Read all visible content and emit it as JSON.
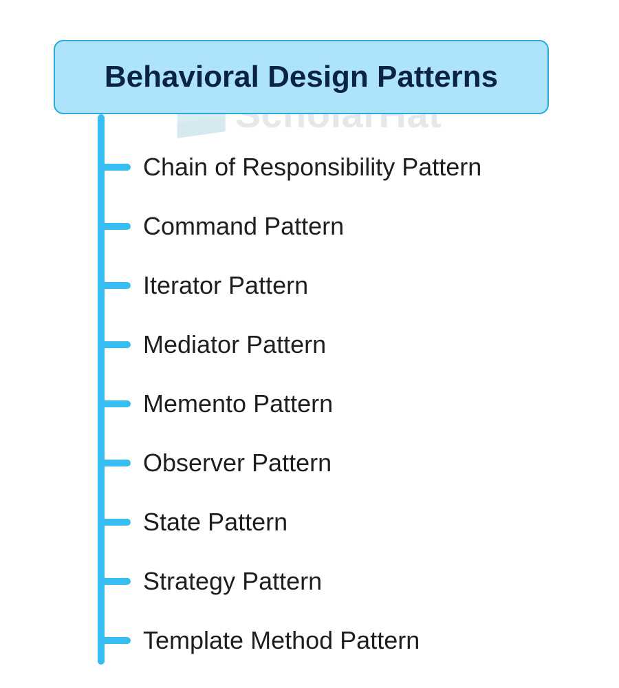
{
  "watermark": {
    "text": "ScholarHat"
  },
  "title": "Behavioral Design Patterns",
  "colors": {
    "title_bg": "#aee4fb",
    "title_border": "#2aa9e0",
    "title_text": "#0b2344",
    "line": "#37bdf1",
    "item_text": "#1d1e20"
  },
  "items": [
    {
      "label": "Chain of Responsibility Pattern"
    },
    {
      "label": "Command Pattern"
    },
    {
      "label": "Iterator Pattern"
    },
    {
      "label": "Mediator Pattern"
    },
    {
      "label": "Memento Pattern"
    },
    {
      "label": "Observer Pattern"
    },
    {
      "label": "State Pattern"
    },
    {
      "label": "Strategy Pattern"
    },
    {
      "label": "Template Method Pattern"
    }
  ]
}
